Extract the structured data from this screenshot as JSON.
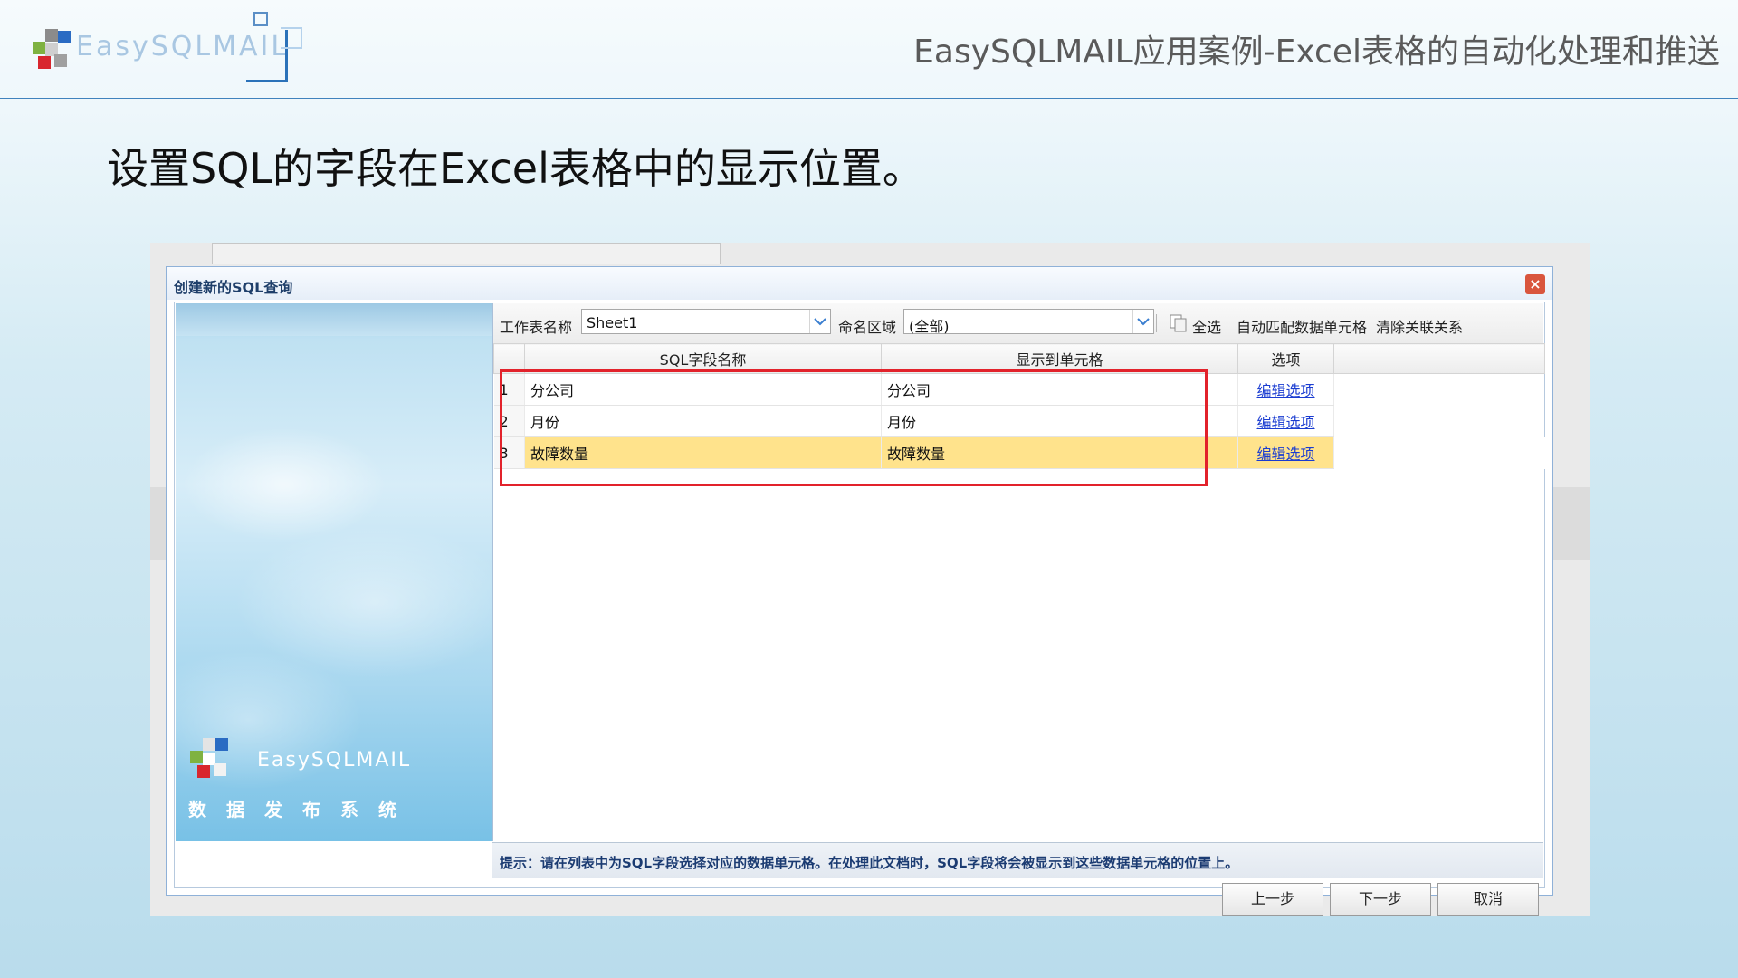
{
  "header": {
    "logo_text": "EasySQLMAIL",
    "title": "EasySQLMAIL应用案例-Excel表格的自动化处理和推送"
  },
  "slide": {
    "heading": "设置SQL的字段在Excel表格中的显示位置。"
  },
  "dialog": {
    "title": "创建新的SQL查询",
    "close_label": "×",
    "side_logo_text": "EasySQLMAIL",
    "side_subtitle": "数据发布系统",
    "toolbar": {
      "sheet_label": "工作表名称",
      "sheet_value": "Sheet1",
      "range_label": "命名区域",
      "range_value": "(全部)",
      "select_all": "全选",
      "auto_match": "自动匹配数据单元格",
      "clear_relations": "清除关联关系"
    },
    "grid": {
      "columns": [
        "",
        "SQL字段名称",
        "显示到单元格",
        "选项",
        ""
      ],
      "rows": [
        {
          "num": "1",
          "field": "分公司",
          "cell": "分公司",
          "option": "编辑选项",
          "selected": false
        },
        {
          "num": "2",
          "field": "月份",
          "cell": "月份",
          "option": "编辑选项",
          "selected": false
        },
        {
          "num": "3",
          "field": "故障数量",
          "cell": "故障数量",
          "option": "编辑选项",
          "selected": true
        }
      ]
    },
    "tip": "提示：请在列表中为SQL字段选择对应的数据单元格。在处理此文档时，SQL字段将会被显示到这些数据单元格的位置上。",
    "buttons": {
      "prev": "上一步",
      "next": "下一步",
      "cancel": "取消"
    }
  }
}
